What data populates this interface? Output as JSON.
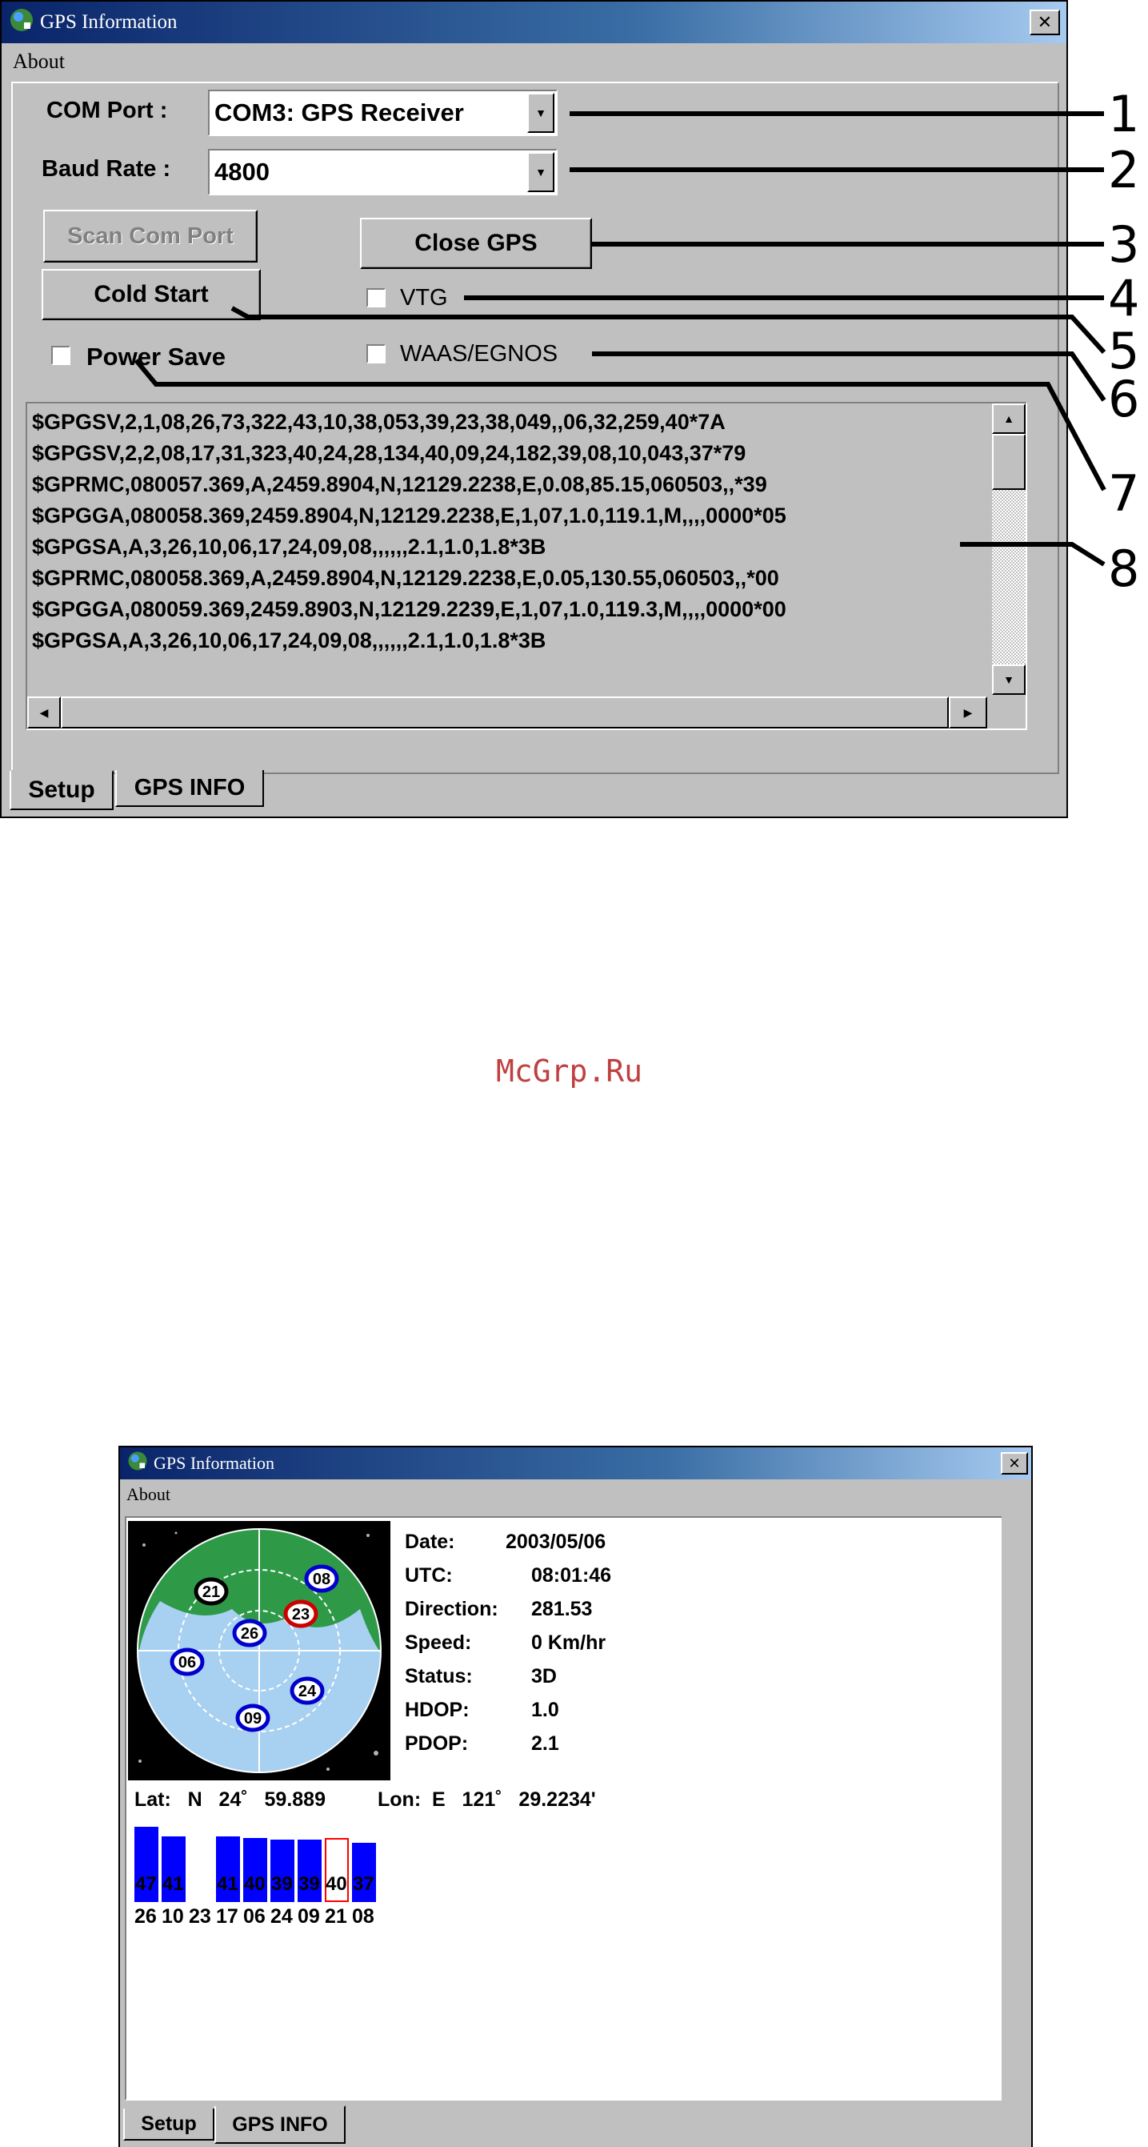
{
  "window_title": "GPS Information",
  "close_glyph": "✕",
  "menu_about": "About",
  "setup": {
    "com_port_label": "COM Port :",
    "com_port_value": "COM3:  GPS Receiver",
    "baud_rate_label": "Baud Rate :",
    "baud_rate_value": "4800",
    "scan_button": "Scan Com Port",
    "close_gps_button": "Close GPS",
    "cold_start_button": "Cold Start",
    "vtg_label": "VTG",
    "waas_label": "WAAS/EGNOS",
    "power_save_label": "Power Save",
    "nmea_lines": [
      "$GPGSV,2,1,08,26,73,322,43,10,38,053,39,23,38,049,,06,32,259,40*7A",
      "$GPGSV,2,2,08,17,31,323,40,24,28,134,40,09,24,182,39,08,10,043,37*79",
      "$GPRMC,080057.369,A,2459.8904,N,12129.2238,E,0.08,85.15,060503,,*39",
      "$GPGGA,080058.369,2459.8904,N,12129.2238,E,1,07,1.0,119.1,M,,,,0000*05",
      "$GPGSA,A,3,26,10,06,17,24,09,08,,,,,,2.1,1.0,1.8*3B",
      "$GPRMC,080058.369,A,2459.8904,N,12129.2238,E,0.05,130.55,060503,,*00",
      "$GPGGA,080059.369,2459.8903,N,12129.2239,E,1,07,1.0,119.3,M,,,,0000*00",
      "$GPGSA,A,3,26,10,06,17,24,09,08,,,,,,2.1,1.0,1.8*3B"
    ],
    "callouts": [
      "1",
      "2",
      "3",
      "4",
      "5",
      "6",
      "7",
      "8"
    ]
  },
  "tabs": {
    "setup": "Setup",
    "gps_info": "GPS INFO"
  },
  "watermark": "McGrp.Ru",
  "gps_info": {
    "date_label": "Date:",
    "date_value": "2003/05/06",
    "utc_label": "UTC:",
    "utc_value": "08:01:46",
    "direction_label": "Direction:",
    "direction_value": "281.53",
    "speed_label": "Speed:",
    "speed_value": "0 Km/hr",
    "status_label": "Status:",
    "status_value": "3D",
    "hdop_label": "HDOP:",
    "hdop_value": "1.0",
    "pdop_label": "PDOP:",
    "pdop_value": "2.1",
    "lat_line": "Lat:   N   24˚   59.889",
    "lon_line": "Lon:  E   121˚   29.2234'",
    "sky_sats": [
      {
        "id": "21",
        "color": "#ffffff",
        "ring": "#000000"
      },
      {
        "id": "08",
        "color": "#ffffff",
        "ring": "#0000cc"
      },
      {
        "id": "23",
        "color": "#ffffff",
        "ring": "#cc0000"
      },
      {
        "id": "26",
        "color": "#ffffff",
        "ring": "#0000cc"
      },
      {
        "id": "06",
        "color": "#ffffff",
        "ring": "#0000cc"
      },
      {
        "id": "24",
        "color": "#ffffff",
        "ring": "#0000cc"
      },
      {
        "id": "09",
        "color": "#ffffff",
        "ring": "#0000cc"
      }
    ],
    "snr_bars": [
      {
        "prn": "26",
        "snr": 47,
        "label": "47",
        "used": true
      },
      {
        "prn": "10",
        "snr": 41,
        "label": "41",
        "used": true
      },
      {
        "prn": "23",
        "snr": 0,
        "label": "",
        "used": true
      },
      {
        "prn": "17",
        "snr": 41,
        "label": "41",
        "used": true
      },
      {
        "prn": "06",
        "snr": 40,
        "label": "40",
        "used": true
      },
      {
        "prn": "24",
        "snr": 39,
        "label": "39",
        "used": true
      },
      {
        "prn": "09",
        "snr": 39,
        "label": "39",
        "used": true
      },
      {
        "prn": "21",
        "snr": 40,
        "label": "40",
        "used": false
      },
      {
        "prn": "08",
        "snr": 37,
        "label": "37",
        "used": true
      }
    ],
    "bar_color": "#0000ff",
    "unused_outline": "#ff0000"
  }
}
